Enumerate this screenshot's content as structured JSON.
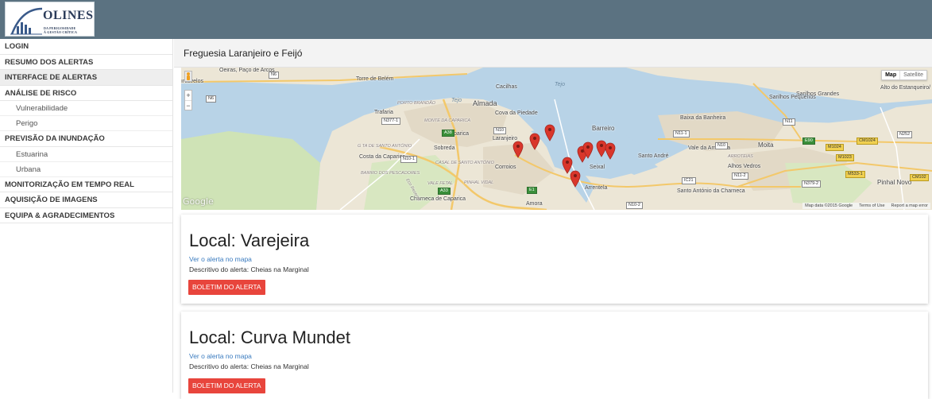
{
  "header": {
    "logo_text": "OLINES",
    "logo_sub1": "DA PERIGOSIDADE",
    "logo_sub2": "À GESTÃO CRÍTICA"
  },
  "sidebar": {
    "items": [
      {
        "label": "LOGIN"
      },
      {
        "label": "RESUMO DOS ALERTAS"
      },
      {
        "label": "INTERFACE DE ALERTAS",
        "active": true
      },
      {
        "label": "ANÁLISE DE RISCO"
      },
      {
        "label": "Vulnerabilidade"
      },
      {
        "label": "Perigo"
      },
      {
        "label": "PREVISÃO DA INUNDAÇÃO"
      },
      {
        "label": "Estuarina"
      },
      {
        "label": "Urbana"
      },
      {
        "label": "MONITORIZAÇÃO EM TEMPO REAL"
      },
      {
        "label": "AQUISIÇÃO DE IMAGENS"
      },
      {
        "label": "EQUIPA & AGRADECIMENTOS"
      }
    ]
  },
  "page": {
    "title": "Freguesia Laranjeiro e Feijó"
  },
  "map": {
    "type_map": "Map",
    "type_satellite": "Satellite",
    "zoom_in": "+",
    "zoom_out": "−",
    "google_logo": "Google",
    "footer": {
      "data": "Map data ©2015 Google",
      "terms": "Terms of Use",
      "report": "Report a map error"
    },
    "labels": {
      "oeiras": "Oeiras, Paço de Arcos",
      "carcavelos": "ırcavelos",
      "belem": "Torre de Belém",
      "tejo1": "Tejo",
      "tejo2": "Tejo",
      "cacilhas": "Cacilhas",
      "almada": "Almada",
      "cova": "Cova da Piedade",
      "porto_brandao": "PORTO BRANDÃO",
      "trafaria": "Trafaria",
      "monte": "MONTE DA CAPARICA",
      "caparica": "Caparica",
      "laranjeiro": "Laranjeiro",
      "sobreda": "Sobreda",
      "costa": "Costa da Caparica",
      "gta": "G TA DE SANTO ANTÓNIO",
      "casal": "CASAL DE SANTO ANTÓNIO",
      "bairro": "BAIRRO DOS PESCADORES",
      "corroios": "Corroios",
      "vale_fetal": "VALE FETAL",
      "pinhal_vidal": "PINHAL VIDAL",
      "charneca": "Charneca de Caparica",
      "amora": "Amora",
      "barreiro": "Barreiro",
      "baixa": "Baixa da Banheira",
      "seixal": "Seixal",
      "arrentela": "Arrentela",
      "santo_andre": "Santo André",
      "vale_amoreira": "Vale da Amoreira",
      "arroteias": "ARROTEIAS",
      "alhos_vedros": "Alhos Vedros",
      "moita": "Moita",
      "sarilhos_pequenos": "Sarilhos Pequenos",
      "sarilhos_grandes": "Sarilhos Grandes",
      "alto_estanqueiro": "Alto do Estanqueiro/ Jardia",
      "santo_antonio": "Santo António da Charneca",
      "pinhal_novo": "Pinhal Novo",
      "eco": "Eco Reserve"
    },
    "shields": {
      "n6a": "N6",
      "n6b": "N6",
      "n377": "N377-1",
      "a38": "A38",
      "n10": "N10",
      "n10_1": "N10-1",
      "a33": "A33",
      "n10_2": "N10-2",
      "n11": "N11",
      "n11_1": "N11-1",
      "n11_2": "N11-2",
      "ic21": "IC21",
      "n379": "N379-2",
      "m1024a": "M1024",
      "m1023": "M1023",
      "cm1024": "CM1024",
      "n252": "N252",
      "e90": "E90",
      "m533": "M533-1",
      "cm102": "CM102",
      "e1": "E1",
      "n10b": "N10"
    }
  },
  "alerts": [
    {
      "title": "Local: Varejeira",
      "link_label": "Ver o alerta no mapa",
      "description": "Descritivo do alerta: Cheias na Marginal",
      "button_label": "BOLETIM DO ALERTA"
    },
    {
      "title": "Local: Curva Mundet",
      "link_label": "Ver o alerta no mapa",
      "description": "Descritivo do alerta: Cheias na Marginal",
      "button_label": "BOLETIM DO ALERTA"
    }
  ],
  "colors": {
    "header_bg": "#5b7281",
    "button_red": "#e8453c",
    "link_blue": "#3a7bbf",
    "pin_red": "#d9362b"
  }
}
